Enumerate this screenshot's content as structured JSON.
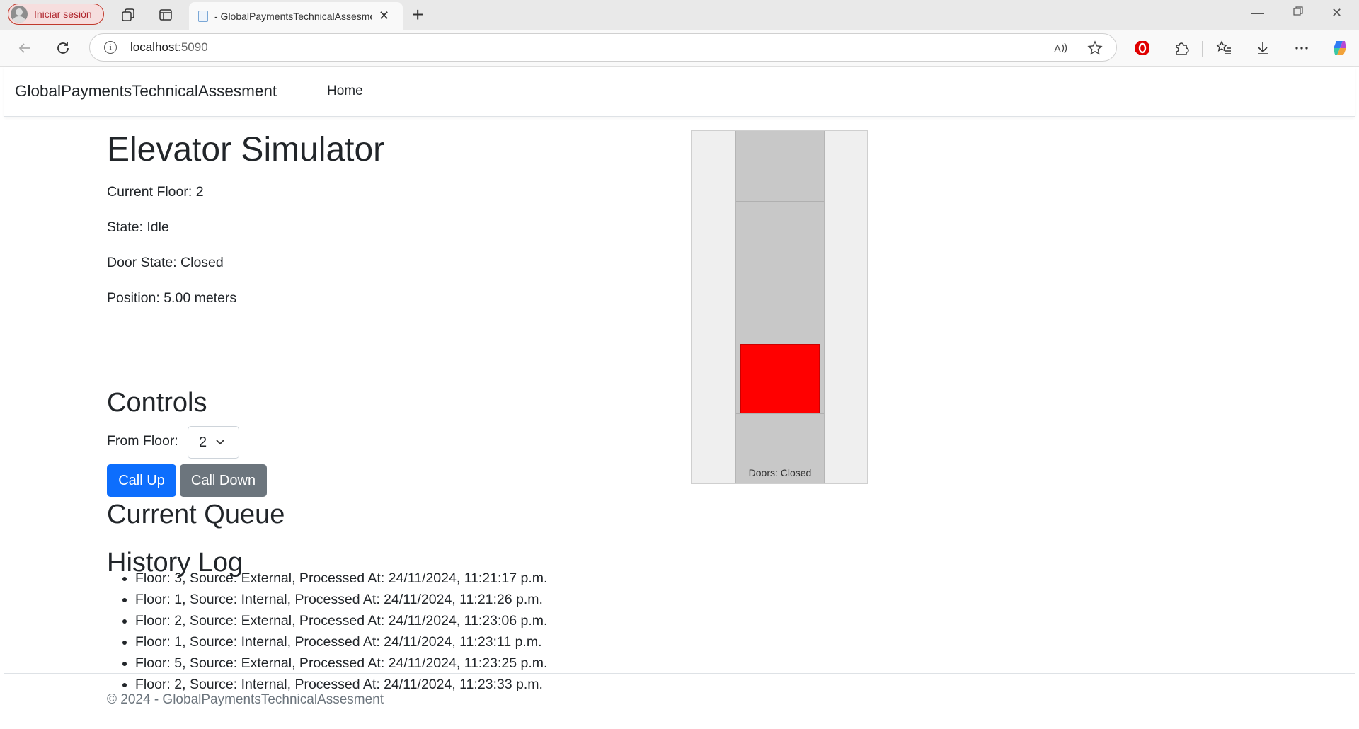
{
  "browser": {
    "profile_label": "Iniciar sesión",
    "tab_title": "- GlobalPaymentsTechnicalAssesment",
    "url_host": "localhost",
    "url_port": ":5090"
  },
  "nav": {
    "brand": "GlobalPaymentsTechnicalAssesment",
    "home": "Home"
  },
  "simulator": {
    "title": "Elevator Simulator",
    "current_floor": "Current Floor: 2",
    "state": "State: Idle",
    "door_state": "Door State: Closed",
    "position": "Position: 5.00 meters"
  },
  "controls": {
    "heading": "Controls",
    "from_floor_label": "From Floor:",
    "selected_floor": "2",
    "call_up": "Call Up",
    "call_down": "Call Down"
  },
  "queue": {
    "heading": "Current Queue"
  },
  "history": {
    "heading": "History Log",
    "entries": [
      "Floor: 3, Source: External, Processed At: 24/11/2024, 11:21:17 p.m.",
      "Floor: 1, Source: Internal, Processed At: 24/11/2024, 11:21:26 p.m.",
      "Floor: 2, Source: External, Processed At: 24/11/2024, 11:23:06 p.m.",
      "Floor: 1, Source: Internal, Processed At: 24/11/2024, 11:23:11 p.m.",
      "Floor: 5, Source: External, Processed At: 24/11/2024, 11:23:25 p.m.",
      "Floor: 2, Source: Internal, Processed At: 24/11/2024, 11:23:33 p.m."
    ]
  },
  "elevator_visual": {
    "doors_label": "Doors: Closed",
    "car_color": "#ff0000",
    "current_floor": 2,
    "floor_count": 5
  },
  "footer": {
    "text": "© 2024 - GlobalPaymentsTechnicalAssesment"
  }
}
